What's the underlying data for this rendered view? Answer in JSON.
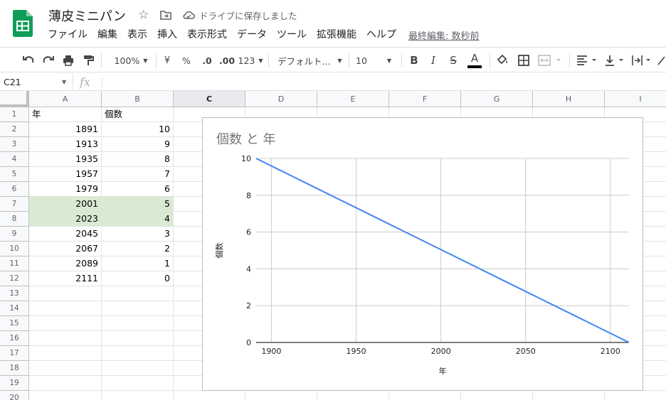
{
  "app": {
    "doc_title": "薄皮ミニパン",
    "save_status": "ドライブに保存しました",
    "icons": [
      "sheets-logo-icon",
      "star-icon",
      "move-folder-icon",
      "cloud-icon"
    ],
    "brand_color": "#0f9d58"
  },
  "menu": {
    "items": [
      "ファイル",
      "編集",
      "表示",
      "挿入",
      "表示形式",
      "データ",
      "ツール",
      "拡張機能",
      "ヘルプ"
    ],
    "last_edit": "最終編集: 数秒前"
  },
  "toolbar": {
    "zoom": "100%",
    "currency": "¥",
    "percent": "%",
    "decrease_decimal": ".0",
    "increase_decimal": ".00",
    "more_formats": "123",
    "font": "デフォルト...",
    "font_size": "10",
    "bold": "B",
    "italic": "I",
    "strikethrough": "S",
    "text_color_letter": "A"
  },
  "formula_bar": {
    "name_box": "C21",
    "fx": "fx",
    "content": ""
  },
  "sheet": {
    "columns": [
      "A",
      "B",
      "C",
      "D",
      "E",
      "F",
      "G",
      "H",
      "I"
    ],
    "selected_column": "C",
    "rows": [
      "1",
      "2",
      "3",
      "4",
      "5",
      "6",
      "7",
      "8",
      "9",
      "10",
      "11",
      "12",
      "13",
      "14",
      "15",
      "16",
      "17",
      "18",
      "19",
      "20"
    ],
    "header_row": [
      "年",
      "個数"
    ],
    "data": [
      [
        "1891",
        "10"
      ],
      [
        "1913",
        "9"
      ],
      [
        "1935",
        "8"
      ],
      [
        "1957",
        "7"
      ],
      [
        "1979",
        "6"
      ],
      [
        "2001",
        "5"
      ],
      [
        "2023",
        "4"
      ],
      [
        "2045",
        "3"
      ],
      [
        "2067",
        "2"
      ],
      [
        "2089",
        "1"
      ],
      [
        "2111",
        "0"
      ]
    ],
    "highlighted_rows": [
      7,
      8
    ],
    "highlight_color": "#d9ead3"
  },
  "chart_data": {
    "type": "line",
    "title": "個数 と 年",
    "xlabel": "年",
    "ylabel": "個数",
    "x": [
      1891,
      1913,
      1935,
      1957,
      1979,
      2001,
      2023,
      2045,
      2067,
      2089,
      2111
    ],
    "series": [
      {
        "values": [
          10,
          9,
          8,
          7,
          6,
          5,
          4,
          3,
          2,
          1,
          0
        ],
        "color": "#4285f4"
      }
    ],
    "xlim": [
      1891,
      2111
    ],
    "ylim": [
      0,
      10
    ],
    "x_ticks": [
      1900,
      1950,
      2000,
      2050,
      2100
    ],
    "y_ticks": [
      0,
      2,
      4,
      6,
      8,
      10
    ],
    "grid": true,
    "legend": "none"
  }
}
